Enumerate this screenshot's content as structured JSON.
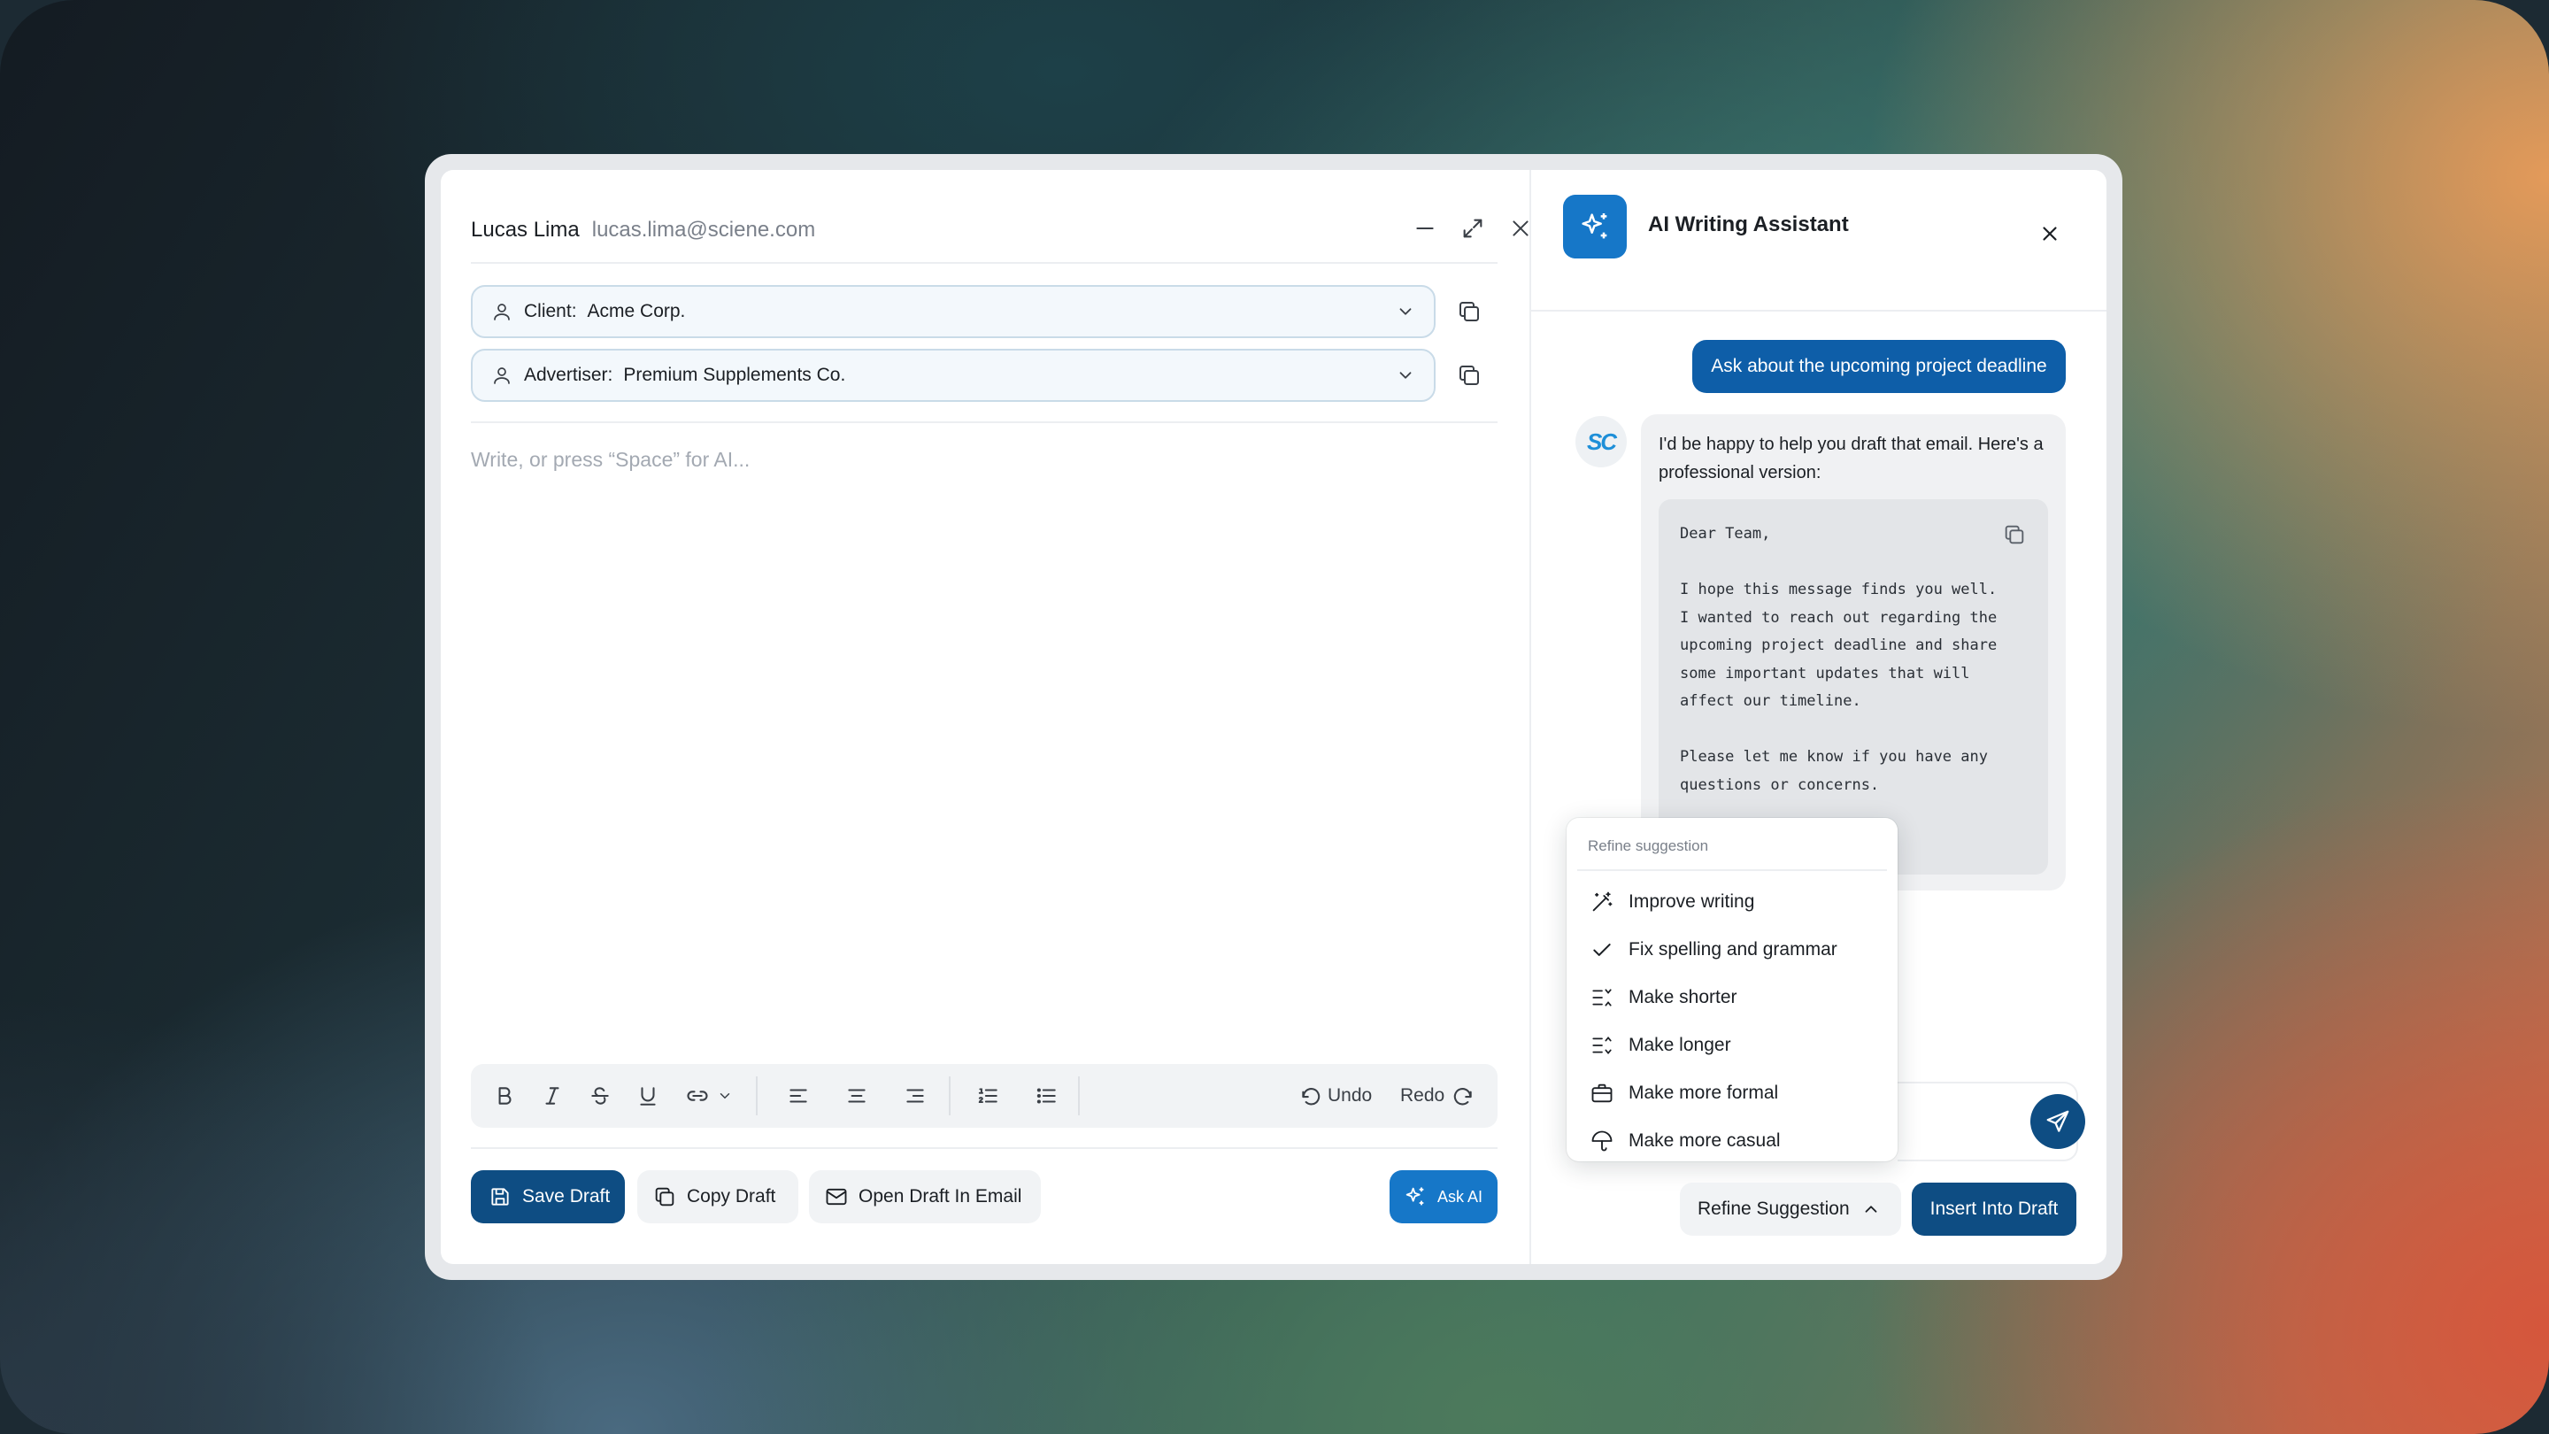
{
  "colors": {
    "primary": "#0e4d83",
    "accent": "#1677c8",
    "user_bubble": "#0e5ea8",
    "field_bg": "#f3f8fc",
    "field_border": "#c9dbe8"
  },
  "composer": {
    "sender_name": "Lucas Lima",
    "sender_email": "lucas.lima@sciene.com",
    "window_controls": [
      "minimize-icon",
      "expand-icon",
      "close-icon"
    ],
    "fields": [
      {
        "label": "Client:",
        "value": "Acme Corp.",
        "icon": "user-icon"
      },
      {
        "label": "Advertiser:",
        "value": "Premium Supplements Co.",
        "icon": "user-icon"
      }
    ],
    "editor_placeholder": "Write, or press “Space” for AI...",
    "toolbar": {
      "format_icons": [
        "bold-icon",
        "italic-icon",
        "strikethrough-icon",
        "underline-icon",
        "link-icon"
      ],
      "align_icons": [
        "align-left-icon",
        "align-center-icon",
        "align-right-icon"
      ],
      "list_icons": [
        "ordered-list-icon",
        "bullet-list-icon"
      ],
      "undo_label": "Undo",
      "redo_label": "Redo"
    },
    "actions": {
      "save_label": "Save Draft",
      "copy_label": "Copy Draft",
      "open_label": "Open Draft In Email",
      "ask_ai_label": "Ask AI"
    }
  },
  "assistant": {
    "title": "AI Writing Assistant",
    "user_message": "Ask about the upcoming project deadline",
    "avatar_text": "SC",
    "ai_intro": "I'd be happy to help you draft that email. Here's a professional version:",
    "draft_lines": [
      "Dear Team,",
      "",
      "I hope this message finds you well.",
      "I wanted to reach out regarding the",
      "upcoming project deadline and share",
      "some important updates that will",
      "affect our timeline.",
      "",
      "Please let me know if you have any",
      "questions or concerns."
    ],
    "refine_menu": {
      "header": "Refine suggestion",
      "items": [
        {
          "label": "Improve writing",
          "icon": "magic-wand-icon"
        },
        {
          "label": "Fix spelling and grammar",
          "icon": "check-icon"
        },
        {
          "label": "Make shorter",
          "icon": "shorten-text-icon"
        },
        {
          "label": "Make longer",
          "icon": "lengthen-text-icon"
        },
        {
          "label": "Make more formal",
          "icon": "briefcase-icon"
        },
        {
          "label": "Make more casual",
          "icon": "umbrella-icon"
        }
      ]
    },
    "refine_button_label": "Refine Suggestion",
    "insert_button_label": "Insert Into Draft"
  }
}
